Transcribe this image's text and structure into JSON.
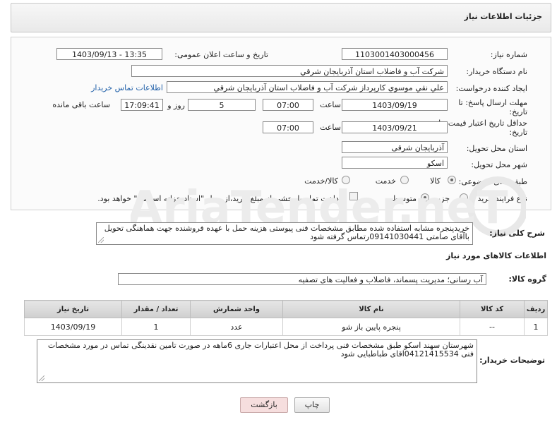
{
  "header": {
    "title": "جزئیات اطلاعات نیاز"
  },
  "fields": {
    "need_number": {
      "label": "شماره نیاز:",
      "value": "1103001403000456"
    },
    "announce_datetime": {
      "label": "تاریخ و ساعت اعلان عمومی:",
      "value": "1403/09/13 - 13:35"
    },
    "buyer_org": {
      "label": "نام دستگاه خریدار:",
      "value": "شرکت آب و فاضلاب استان آذربایجان شرقي"
    },
    "requester": {
      "label": "ایجاد کننده درخواست:",
      "value": "علي نقي موسوي كارپرداز شركت آب و فاضلاب استان آذربايجان شرقي",
      "contact_link": "اطلاعات تماس خریدار"
    },
    "reply_deadline": {
      "label_line1": "مهلت ارسال پاسخ: تا",
      "label_line2": "تاریخ:",
      "date": "1403/09/19",
      "time_label": "ساعت",
      "time": "07:00",
      "days": "5",
      "days_label": "روز و",
      "remaining": "17:09:41",
      "remaining_label": "ساعت باقی مانده"
    },
    "price_validity": {
      "label_line1": "حداقل تاریخ اعتبار قیمت: تا",
      "label_line2": "تاریخ:",
      "date": "1403/09/21",
      "time_label": "ساعت",
      "time": "07:00"
    },
    "delivery_province": {
      "label": "استان محل تحویل:",
      "value": "آذربایجان شرقی"
    },
    "delivery_city": {
      "label": "شهر محل تحویل:",
      "value": "اسکو"
    },
    "category": {
      "label": "طبقه بندی موضوعی:",
      "opt1": "کالا",
      "opt2": "خدمت",
      "opt3": "کالا/خدمت"
    },
    "purchase_type": {
      "label": "نوع فرآیند خرید :",
      "opt1": "جزیی",
      "opt2": "متوسط",
      "note": "پرداخت تمام یا بخشی از مبلغ خرید،از محل \"اسناد خزانه اسلامی\" خواهد بود."
    }
  },
  "description": {
    "label": "شرح کلی نیاز:",
    "text": "خریدپنجره مشابه استفاده شده مطابق مشخصات فنی پیوستی  هزینه حمل با عهده فروشنده جهت هماهنگی تحویل باآقای صامتی 09141030441رتماس گرفته شود"
  },
  "goods": {
    "section_title": "اطلاعات کالاهای مورد نیاز",
    "group_label": "گروه کالا:",
    "group_value": "آب رسانی؛ مدیریت پسماند، فاضلاب و فعالیت های تصفیه",
    "columns": [
      "ردیف",
      "کد کالا",
      "نام کالا",
      "واحد شمارش",
      "تعداد / مقدار",
      "تاریخ نیاز"
    ],
    "rows": [
      [
        "1",
        "--",
        "پنجره پایین باز شو",
        "عدد",
        "1",
        "1403/09/19"
      ]
    ]
  },
  "buyer_notes": {
    "label": "توضیحات خریدار:",
    "text": "شهرستان سهند اسکو طبق مشخصات فنی پرداخت از محل اعتبارات جاری  6ماهه در صورت تامین نقدینگی تماس در مورد مشخصات فنی 04121415534اقای  طباطبایی  شود"
  },
  "buttons": {
    "print": "چاپ",
    "back": "بازگشت"
  },
  "colors": {
    "back_button_bg": "#f6dede",
    "link": "#1f5fa8"
  }
}
